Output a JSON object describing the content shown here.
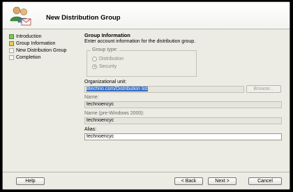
{
  "header": {
    "title": "New Distribution Group",
    "icon": "group-users-icon"
  },
  "nav": {
    "items": [
      {
        "label": "Introduction",
        "state": "done"
      },
      {
        "label": "Group Information",
        "state": "current"
      },
      {
        "label": "New Distribution Group",
        "state": "pending"
      },
      {
        "label": "Completion",
        "state": "pending"
      }
    ]
  },
  "form": {
    "section_title": "Group Information",
    "section_desc": "Enter account information for the distribution group.",
    "group_type": {
      "label": "Group type:",
      "options": [
        {
          "label": "Distribution",
          "selected": false
        },
        {
          "label": "Security",
          "selected": true
        }
      ]
    },
    "ou_label": "Organizational unit:",
    "ou_value": "8techno.com/Distribution list",
    "browse_label": "Browse...",
    "name_label": "Name:",
    "name_value": "technoencyc",
    "prewin_label": "Name (pre-Windows 2000):",
    "prewin_value": "technoencyc",
    "alias_label": "Alias:",
    "alias_value": "technoencyc"
  },
  "footer": {
    "help": "Help",
    "back": "< Back",
    "next": "Next >",
    "cancel": "Cancel"
  }
}
